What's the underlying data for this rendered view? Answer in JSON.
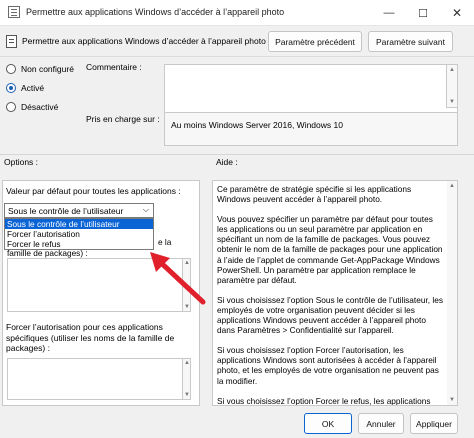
{
  "window": {
    "title": "Permettre aux applications Windows d’accéder à l’appareil photo",
    "minimize": "—",
    "maximize": "☐",
    "close": "✕"
  },
  "header": {
    "policy_name": "Permettre aux applications Windows d’accéder à l’appareil photo",
    "prev_label": "Paramètre précédent",
    "next_label": "Paramètre suivant"
  },
  "state": {
    "options": [
      {
        "label": "Non configuré",
        "selected": false
      },
      {
        "label": "Activé",
        "selected": true
      },
      {
        "label": "Désactivé",
        "selected": false
      }
    ]
  },
  "comment": {
    "label": "Commentaire :",
    "value": ""
  },
  "supported": {
    "label": "Pris en charge sur :",
    "value": "Au moins Windows Server 2016, Windows 10"
  },
  "sections": {
    "options_label": "Options :",
    "help_label": "Aide :"
  },
  "options_panel": {
    "default_label": "Valeur par défaut pour toutes les applications :",
    "dropdown_value": "Sous le contrôle de l’utilisateur",
    "dropdown_items": [
      "Sous le contrôle de l’utilisateur",
      "Forcer l’autorisation",
      "Forcer le refus"
    ],
    "partial_label_a": "e la",
    "partial_label_b": "famille  de  packages) :",
    "force_allow_label": "Forcer l’autorisation pour ces applications spécifiques (utiliser les noms de la famille de packages) :"
  },
  "help": {
    "paragraphs": [
      "Ce paramètre de stratégie spécifie si les applications Windows peuvent accéder à l’appareil photo.",
      "Vous pouvez spécifier un paramètre par défaut pour toutes les applications ou un seul paramètre par application en spécifiant un nom de la famille de packages. Vous pouvez obtenir le nom de la famille de packages pour une application à l’aide de l’applet de commande Get-AppPackage Windows PowerShell. Un paramètre par application remplace le paramètre par défaut.",
      "Si vous choisissez l’option Sous le contrôle de l’utilisateur, les employés de votre organisation peuvent décider si les applications Windows peuvent accéder à l’appareil photo dans Paramètres > Confidentialité sur l’appareil.",
      "Si vous choisissez l’option Forcer l’autorisation, les applications Windows sont autorisées à accéder à l’appareil photo, et les employés de votre organisation ne peuvent pas la modifier.",
      "Si vous choisissez l’option Forcer le refus, les applications Windows ne sont pas autorisées à accéder à l’appareil photo, et les"
    ]
  },
  "footer": {
    "ok": "OK",
    "cancel": "Annuler",
    "apply": "Appliquer"
  },
  "colors": {
    "accent": "#0a64d6",
    "arrow": "#e0202a"
  }
}
